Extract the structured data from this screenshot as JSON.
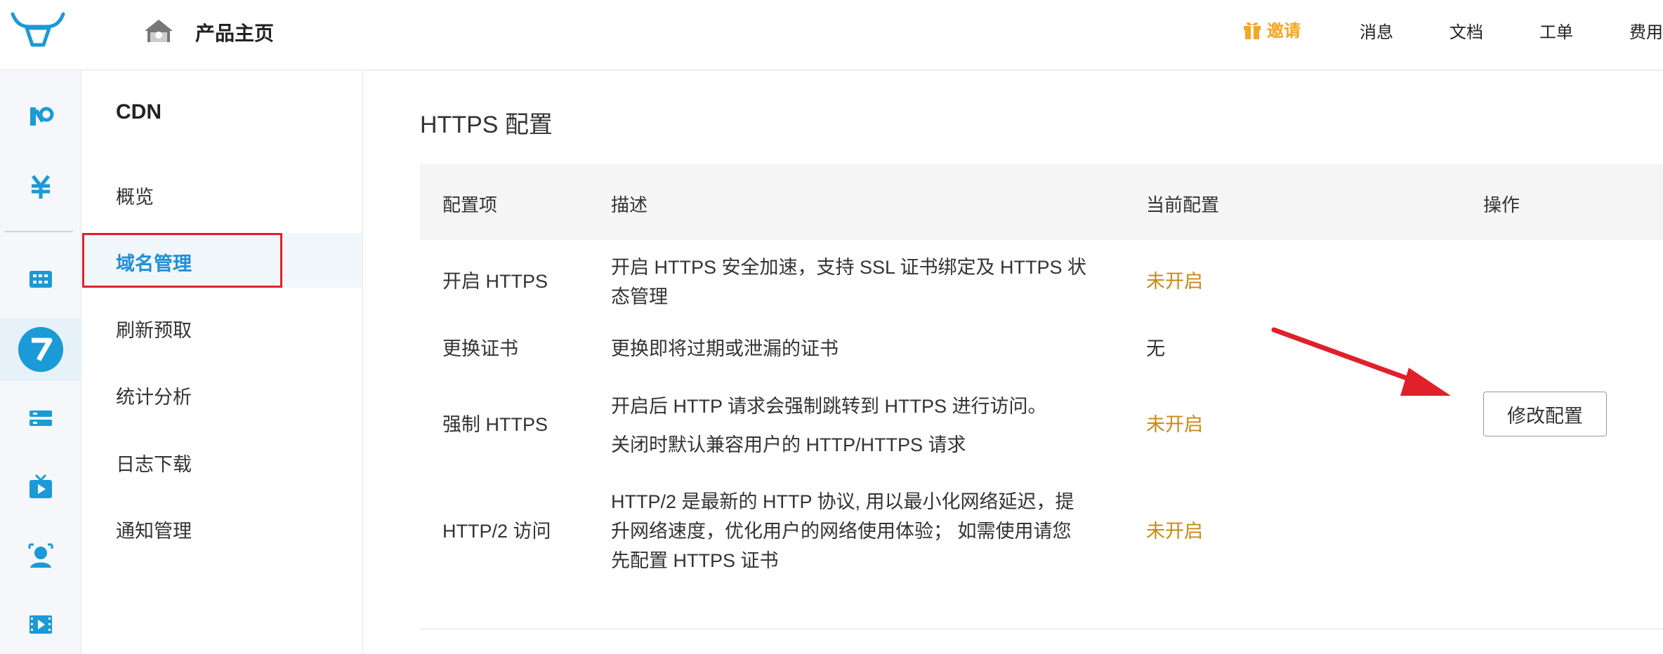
{
  "header": {
    "home_title": "产品主页",
    "nav": {
      "invite": "邀请",
      "messages": "消息",
      "docs": "文档",
      "tickets": "工单",
      "billing": "费用"
    }
  },
  "subnav": {
    "title": "CDN",
    "items": [
      "概览",
      "域名管理",
      "刷新预取",
      "统计分析",
      "日志下载",
      "通知管理"
    ],
    "active": "域名管理"
  },
  "main": {
    "title": "HTTPS 配置",
    "columns": [
      "配置项",
      "描述",
      "当前配置",
      "操作"
    ],
    "rows": [
      {
        "item": "开启 HTTPS",
        "desc_line1": "开启 HTTPS 安全加速，支持 SSL 证书绑定及 HTTPS 状",
        "desc_line2": "态管理",
        "status": "未开启"
      },
      {
        "item": "更换证书",
        "desc_line1": "更换即将过期或泄漏的证书",
        "status": "无"
      },
      {
        "item": "强制 HTTPS",
        "desc_line1": "开启后 HTTP 请求会强制跳转到 HTTPS 进行访问。",
        "desc_line2": "关闭时默认兼容用户的 HTTP/HTTPS 请求",
        "status": "未开启"
      },
      {
        "item": "HTTP/2 访问",
        "desc_line1": "HTTP/2 是最新的 HTTP 协议, 用以最小化网络延迟，提",
        "desc_line2": "升网络速度，优化用户的网络使用体验； 如需使用请您",
        "desc_line3": "先配置 HTTPS 证书",
        "status": "未开启"
      }
    ],
    "action_button": "修改配置"
  },
  "colors": {
    "accent": "#1f8fd6",
    "status_off": "#c98a14",
    "invite": "#f5a623",
    "highlight": "#e0202a"
  }
}
